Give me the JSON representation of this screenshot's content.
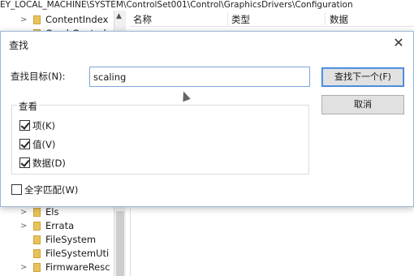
{
  "address_bar": {
    "path": "EY_LOCAL_MACHINE\\SYSTEM\\ControlSet001\\Control\\GraphicsDrivers\\Configuration"
  },
  "tree": {
    "items": [
      {
        "label": "ContentIndex",
        "chevron": ">"
      },
      {
        "label": "CrashControl",
        "chevron": ">"
      },
      {
        "label": "Els",
        "chevron": ">"
      },
      {
        "label": "Errata",
        "chevron": ">"
      },
      {
        "label": "FileSystem",
        "chevron": ""
      },
      {
        "label": "FileSystemUti",
        "chevron": ""
      },
      {
        "label": "FirmwareResc",
        "chevron": ">"
      }
    ]
  },
  "list_header": {
    "name": "名称",
    "type": "类型",
    "data": "数据"
  },
  "dialog": {
    "title": "查找",
    "find_label": "查找目标(N):",
    "find_value": "scaling",
    "find_next_button": "查找下一个(F)",
    "cancel_button": "取消",
    "look_at_group": "查看",
    "options": [
      {
        "label": "项(K)",
        "checked": true
      },
      {
        "label": "值(V)",
        "checked": true
      },
      {
        "label": "数据(D)",
        "checked": true
      }
    ],
    "match_whole": {
      "label": "全字匹配(W)",
      "checked": false
    }
  }
}
